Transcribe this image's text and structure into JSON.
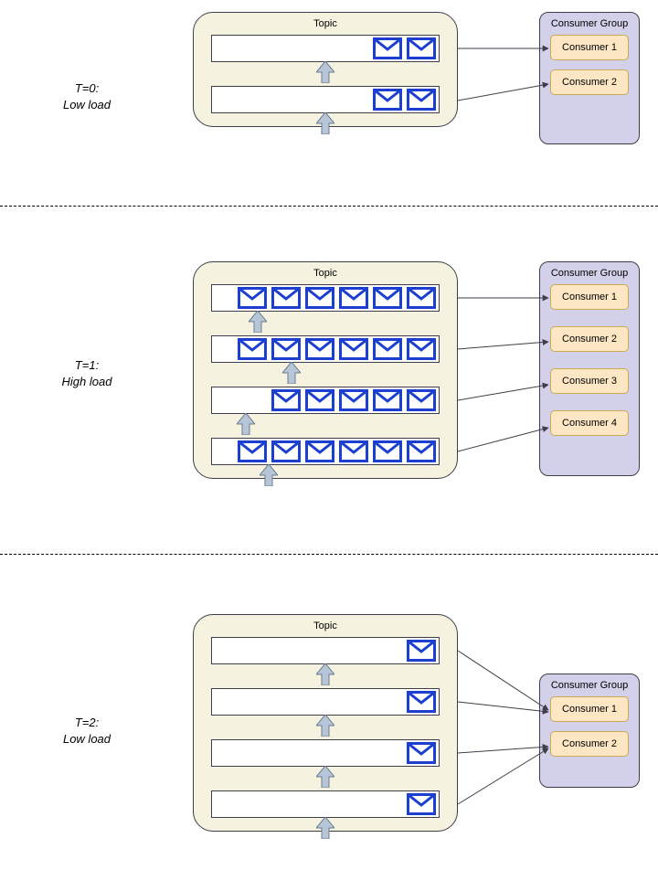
{
  "scenes": {
    "t0": {
      "caption": "T=0:\nLow load",
      "topic_label": "Topic",
      "group_label": "Consumer Group",
      "partitions": [
        {
          "messages": 2
        },
        {
          "messages": 2
        }
      ],
      "consumers": [
        "Consumer 1",
        "Consumer 2"
      ]
    },
    "t1": {
      "caption": "T=1:\nHigh load",
      "topic_label": "Topic",
      "group_label": "Consumer Group",
      "partitions": [
        {
          "messages": 6
        },
        {
          "messages": 6
        },
        {
          "messages": 5
        },
        {
          "messages": 6
        }
      ],
      "consumers": [
        "Consumer 1",
        "Consumer 2",
        "Consumer 3",
        "Consumer 4"
      ]
    },
    "t2": {
      "caption": "T=2:\nLow load",
      "topic_label": "Topic",
      "group_label": "Consumer Group",
      "partitions": [
        {
          "messages": 1
        },
        {
          "messages": 1
        },
        {
          "messages": 1
        },
        {
          "messages": 1
        }
      ],
      "consumers": [
        "Consumer 1",
        "Consumer 2"
      ]
    }
  },
  "icons": {
    "message": "envelope-icon",
    "pointer": "up-arrow-icon",
    "connector": "arrow-right-icon"
  },
  "colors": {
    "topic_bg": "#f5f2df",
    "group_bg": "#d3d1ea",
    "consumer_bg": "#fde6c4",
    "consumer_border": "#c9a951",
    "msg_stroke": "#1a3fd1",
    "arrow_fill": "#b7c6d6",
    "arrow_stroke": "#6b7b94",
    "line": "#3e3e4a"
  }
}
